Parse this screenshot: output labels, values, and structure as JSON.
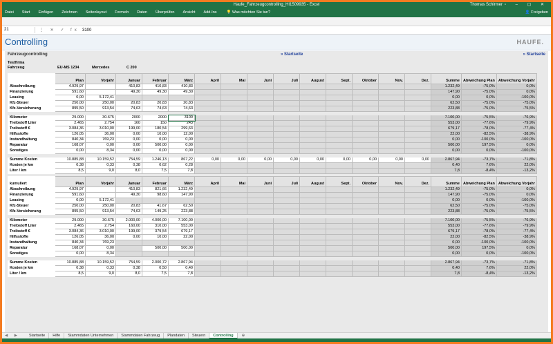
{
  "title": "Haufe_Fahrzeugcontrolling_HI1509935 - Excel",
  "user": "Thomas Schirmer",
  "ribbon_tabs": [
    "Datei",
    "Start",
    "Einfügen",
    "Zeichnen",
    "Seitenlayout",
    "Formeln",
    "Daten",
    "Überprüfen",
    "Ansicht",
    "Add-Ins"
  ],
  "tell_me": "Was möchten Sie tun?",
  "share": "Freigeben",
  "namebox": "21",
  "formula_value": "3100",
  "controlling_title": "Controlling",
  "logo": "HAUFE.",
  "section1": "Fahrzeugcontrolling",
  "startseite": "» Startseite",
  "company": "Testfirma",
  "vehicle_label": "Fahrzeug",
  "plate": "EU-MS 1234",
  "make": "Mercedes",
  "model": "C 200",
  "kumuliert": "kumuliert",
  "headers": [
    "Plan",
    "Vorjahr",
    "Januar",
    "Februar",
    "März",
    "April",
    "Mai",
    "Juni",
    "Juli",
    "August",
    "Sept.",
    "Oktober",
    "Nov.",
    "Dez.",
    "Summe",
    "Abweichung Plan",
    "Abweichung Vorjahr"
  ],
  "table1": [
    [
      "Abschreibung",
      "4.929,97",
      "",
      "410,83",
      "410,83",
      "410,83",
      "",
      "",
      "",
      "",
      "",
      "",
      "",
      "",
      "",
      "1.232,49",
      "-75,0%",
      "0,0%"
    ],
    [
      "Finanzierung",
      "591,60",
      "",
      "49,30",
      "49,30",
      "49,30",
      "",
      "",
      "",
      "",
      "",
      "",
      "",
      "",
      "",
      "147,90",
      "-75,0%",
      "0,0%"
    ],
    [
      "Leasing",
      "0,00",
      "5.172,41",
      "",
      "",
      "",
      "",
      "",
      "",
      "",
      "",
      "",
      "",
      "",
      "",
      "0,00",
      "0,0%",
      "-100,0%"
    ],
    [
      "Kfz-Steuer",
      "250,00",
      "250,00",
      "20,83",
      "20,83",
      "20,83",
      "",
      "",
      "",
      "",
      "",
      "",
      "",
      "",
      "",
      "62,50",
      "-75,0%",
      "-75,0%"
    ],
    [
      "Kfz-Versicherung",
      "895,50",
      "913,54",
      "74,63",
      "74,63",
      "74,63",
      "",
      "",
      "",
      "",
      "",
      "",
      "",
      "",
      "",
      "223,88",
      "-75,0%",
      "-75,5%"
    ],
    null,
    [
      "Kilometer",
      "29.000",
      "30.675",
      "2000",
      "2000",
      "3100",
      "",
      "",
      "",
      "",
      "",
      "",
      "",
      "",
      "",
      "7.100,00",
      "-75,5%",
      "-76,9%"
    ],
    [
      "Treibstoff Liter",
      "2.465",
      "2.754",
      "160",
      "150",
      "243",
      "",
      "",
      "",
      "",
      "",
      "",
      "",
      "",
      "",
      "553,00",
      "-77,6%",
      "-79,9%"
    ],
    [
      "Treibstoff €",
      "3.084,36",
      "3.010,00",
      "199,00",
      "180,54",
      "299,63",
      "",
      "",
      "",
      "",
      "",
      "",
      "",
      "",
      "",
      "679,17",
      "-78,0%",
      "-77,4%"
    ],
    [
      "Hilfsstoffe",
      "126,05",
      "36,00",
      "0,00",
      "10,00",
      "12,00",
      "",
      "",
      "",
      "",
      "",
      "",
      "",
      "",
      "",
      "22,00",
      "-82,5%",
      "-38,9%"
    ],
    [
      "Instandhaltung",
      "840,34",
      "769,23",
      "0,00",
      "0,00",
      "0,00",
      "",
      "",
      "",
      "",
      "",
      "",
      "",
      "",
      "",
      "0,00",
      "-100,0%",
      "-100,0%"
    ],
    [
      "Reparatur",
      "168,07",
      "0,00",
      "0,00",
      "500,00",
      "0,00",
      "",
      "",
      "",
      "",
      "",
      "",
      "",
      "",
      "",
      "500,00",
      "197,5%",
      "0,0%"
    ],
    [
      "Sonstiges",
      "0,00",
      "8,34",
      "0,00",
      "0,00",
      "0,00",
      "",
      "",
      "",
      "",
      "",
      "",
      "",
      "",
      "",
      "0,00",
      "0,0%",
      "-100,0%"
    ],
    null,
    [
      "Summe Kosten",
      "10.885,88",
      "10.159,52",
      "754,59",
      "1.246,13",
      "867,22",
      "0,00",
      "0,00",
      "0,00",
      "0,00",
      "0,00",
      "0,00",
      "0,00",
      "0,00",
      "0,00",
      "2.867,94",
      "-73,7%",
      "-71,8%"
    ],
    [
      "Kosten je km",
      "0,38",
      "0,33",
      "0,38",
      "0,62",
      "0,28",
      "",
      "",
      "",
      "",
      "",
      "",
      "",
      "",
      "",
      "0,40",
      "7,6%",
      "22,0%"
    ],
    [
      "Liter / km",
      "8,5",
      "9,0",
      "8,0",
      "7,5",
      "7,8",
      "",
      "",
      "",
      "",
      "",
      "",
      "",
      "",
      "",
      "7,8",
      "-8,4%",
      "-13,2%"
    ]
  ],
  "table2": [
    [
      "Abschreibung",
      "4.929,97",
      "",
      "410,83",
      "821,66",
      "1.232,49",
      "",
      "",
      "",
      "",
      "",
      "",
      "",
      "",
      "",
      "1.232,49",
      "-75,0%",
      "0,0%"
    ],
    [
      "Finanzierung",
      "591,60",
      "",
      "49,30",
      "98,60",
      "147,90",
      "",
      "",
      "",
      "",
      "",
      "",
      "",
      "",
      "",
      "147,90",
      "-75,0%",
      "0,0%"
    ],
    [
      "Leasing",
      "0,00",
      "5.172,41",
      "",
      "",
      "",
      "",
      "",
      "",
      "",
      "",
      "",
      "",
      "",
      "",
      "0,00",
      "0,0%",
      "-100,0%"
    ],
    [
      "Kfz-Steuer",
      "250,00",
      "250,00",
      "20,83",
      "41,67",
      "62,50",
      "",
      "",
      "",
      "",
      "",
      "",
      "",
      "",
      "",
      "62,50",
      "-75,0%",
      "-75,0%"
    ],
    [
      "Kfz-Versicherung",
      "895,50",
      "913,54",
      "74,63",
      "149,25",
      "223,88",
      "",
      "",
      "",
      "",
      "",
      "",
      "",
      "",
      "",
      "223,88",
      "-75,0%",
      "-75,5%"
    ],
    null,
    [
      "Kilometer",
      "29.000",
      "30.675",
      "2.000,00",
      "4.000,00",
      "7.100,00",
      "",
      "",
      "",
      "",
      "",
      "",
      "",
      "",
      "",
      "7.100,00",
      "-75,5%",
      "-76,9%"
    ],
    [
      "Treibstoff Liter",
      "2.465",
      "2.754",
      "160,00",
      "310,00",
      "553,00",
      "",
      "",
      "",
      "",
      "",
      "",
      "",
      "",
      "",
      "553,00",
      "-77,6%",
      "-79,9%"
    ],
    [
      "Treibstoff €",
      "3.084,36",
      "3.010,00",
      "199,00",
      "379,54",
      "679,17",
      "",
      "",
      "",
      "",
      "",
      "",
      "",
      "",
      "",
      "679,17",
      "-78,0%",
      "-77,4%"
    ],
    [
      "Hilfsstoffe",
      "126,05",
      "36,00",
      "0,00",
      "10,00",
      "22,00",
      "",
      "",
      "",
      "",
      "",
      "",
      "",
      "",
      "",
      "22,00",
      "-82,5%",
      "-38,9%"
    ],
    [
      "Instandhaltung",
      "840,34",
      "769,23",
      "",
      "",
      "",
      "",
      "",
      "",
      "",
      "",
      "",
      "",
      "",
      "",
      "0,00",
      "-100,0%",
      "-100,0%"
    ],
    [
      "Reparatur",
      "168,07",
      "0,00",
      "",
      "500,00",
      "500,00",
      "",
      "",
      "",
      "",
      "",
      "",
      "",
      "",
      "",
      "500,00",
      "197,5%",
      "0,0%"
    ],
    [
      "Sonstiges",
      "0,00",
      "8,34",
      "",
      "",
      "",
      "",
      "",
      "",
      "",
      "",
      "",
      "",
      "",
      "",
      "0,00",
      "0,0%",
      "-100,0%"
    ],
    null,
    [
      "Summe Kosten",
      "10.885,88",
      "10.159,52",
      "754,59",
      "2.000,72",
      "2.867,94",
      "",
      "",
      "",
      "",
      "",
      "",
      "",
      "",
      "",
      "2.867,94",
      "-73,7%",
      "-71,8%"
    ],
    [
      "Kosten je km",
      "0,38",
      "0,33",
      "0,38",
      "0,50",
      "0,40",
      "",
      "",
      "",
      "",
      "",
      "",
      "",
      "",
      "",
      "0,40",
      "7,6%",
      "22,0%"
    ],
    [
      "Liter / km",
      "8,5",
      "9,0",
      "8,0",
      "7,5",
      "7,8",
      "",
      "",
      "",
      "",
      "",
      "",
      "",
      "",
      "",
      "7,8",
      "-8,4%",
      "-13,2%"
    ]
  ],
  "sheet_tabs": [
    "Startseite",
    "Hilfe",
    "Stammdaten Unternehmen",
    "Stammdaten Fahrzeug",
    "Plandaten",
    "Steuern",
    "Controlling"
  ],
  "active_sheet": "Controlling"
}
